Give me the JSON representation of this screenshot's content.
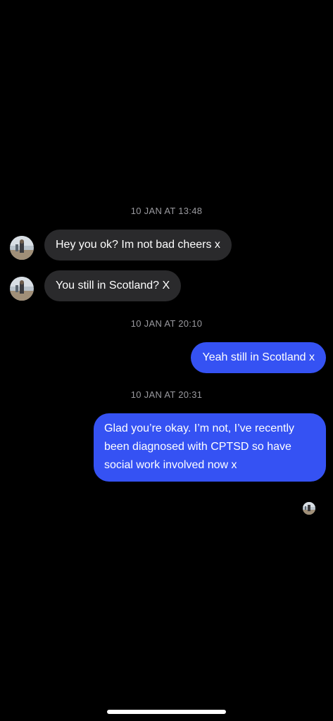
{
  "thread": {
    "groups": [
      {
        "timestamp": "10 JAN AT 13:48",
        "messages": [
          {
            "direction": "incoming",
            "text": "Hey you ok? Im not bad cheers x",
            "avatar": "contact-avatar"
          },
          {
            "direction": "incoming",
            "text": "You still in Scotland? X",
            "avatar": "contact-avatar"
          }
        ]
      },
      {
        "timestamp": "10 JAN AT 20:10",
        "messages": [
          {
            "direction": "outgoing",
            "text": "Yeah still in Scotland x"
          }
        ]
      },
      {
        "timestamp": "10 JAN AT 20:31",
        "messages": [
          {
            "direction": "outgoing",
            "text": "Glad you’re okay. I’m not, I’ve recently been diagnosed with CPTSD so have social work involved now x"
          }
        ]
      }
    ],
    "seen_indicator": "contact-avatar"
  },
  "colors": {
    "background": "#000000",
    "incoming_bubble": "#2a2a2c",
    "outgoing_bubble": "#3552f3",
    "timestamp_text": "#9a9a9f",
    "message_text": "#ffffff"
  }
}
